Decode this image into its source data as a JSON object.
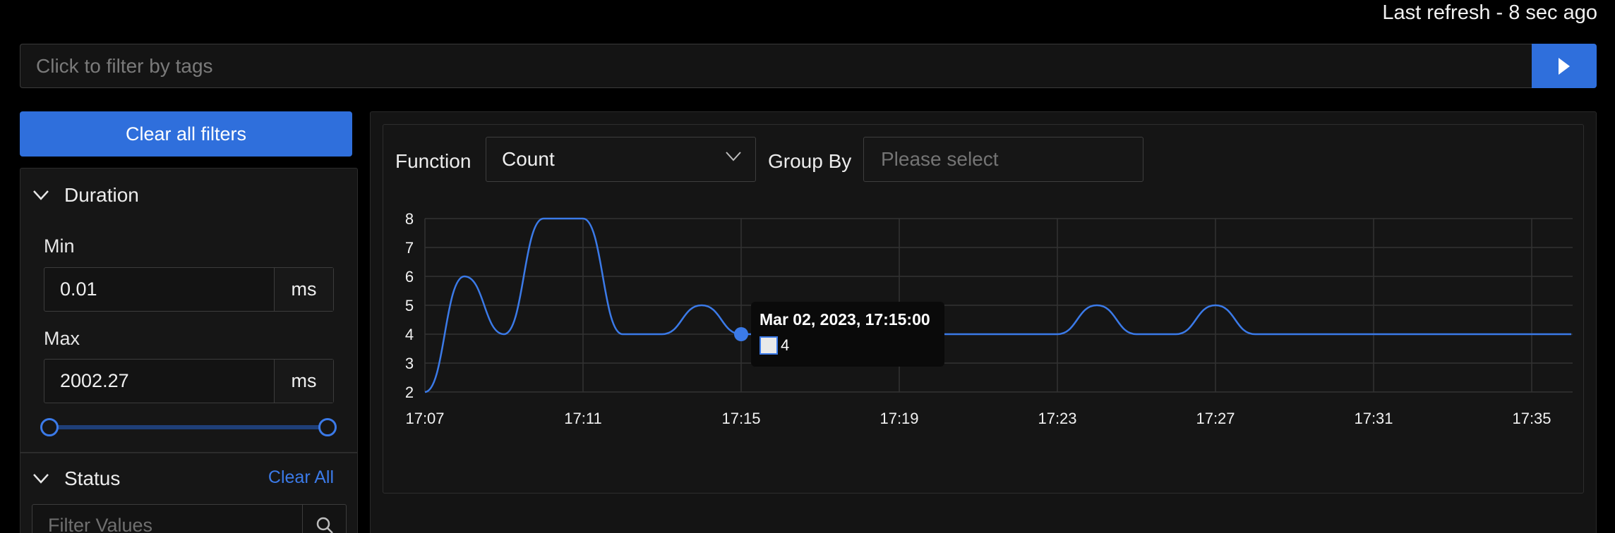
{
  "header": {
    "last_refresh": "Last refresh - 8 sec ago"
  },
  "tag_filter": {
    "placeholder": "Click to filter by tags",
    "submit_icon": "play-icon"
  },
  "sidebar": {
    "clear_all_filters": "Clear all filters",
    "duration": {
      "title": "Duration",
      "min_label": "Min",
      "min_value": "0.01",
      "min_unit": "ms",
      "max_label": "Max",
      "max_value": "2002.27",
      "max_unit": "ms",
      "slider_range": [
        0,
        1
      ]
    },
    "status": {
      "title": "Status",
      "clear_label": "Clear All",
      "filter_placeholder": "Filter Values"
    }
  },
  "controls": {
    "function_label": "Function",
    "function_value": "Count",
    "groupby_label": "Group By",
    "groupby_placeholder": "Please select"
  },
  "tooltip": {
    "title": "Mar 02, 2023, 17:15:00",
    "value": "4"
  },
  "colors": {
    "accent": "#2f6fdc",
    "line": "#3b7ae8",
    "background": "#000000",
    "panel": "#141414"
  },
  "chart_data": {
    "type": "line",
    "x_tick_labels": [
      "17:07",
      "17:11",
      "17:15",
      "17:19",
      "17:23",
      "17:27",
      "17:31",
      "17:35"
    ],
    "y_tick_labels": [
      "2",
      "3",
      "4",
      "5",
      "6",
      "7",
      "8"
    ],
    "ylim": [
      2,
      8
    ],
    "grid": true,
    "series": [
      {
        "x": [
          "17:07",
          "17:08",
          "17:09",
          "17:10",
          "17:11",
          "17:12",
          "17:13",
          "17:14",
          "17:15",
          "17:16",
          "17:17",
          "17:18",
          "17:19",
          "17:20",
          "17:21",
          "17:22",
          "17:23",
          "17:24",
          "17:25",
          "17:26",
          "17:27",
          "17:28",
          "17:29",
          "17:30",
          "17:31",
          "17:32",
          "17:33",
          "17:34",
          "17:35",
          "17:36"
        ],
        "values": [
          2,
          6,
          4,
          8,
          8,
          4,
          4,
          5,
          4,
          4,
          4,
          4,
          4,
          4,
          4,
          4,
          4,
          5,
          4,
          4,
          5,
          4,
          4,
          4,
          4,
          4,
          4,
          4,
          4,
          4
        ]
      }
    ],
    "highlight": {
      "x": "17:15",
      "y": 4
    }
  }
}
